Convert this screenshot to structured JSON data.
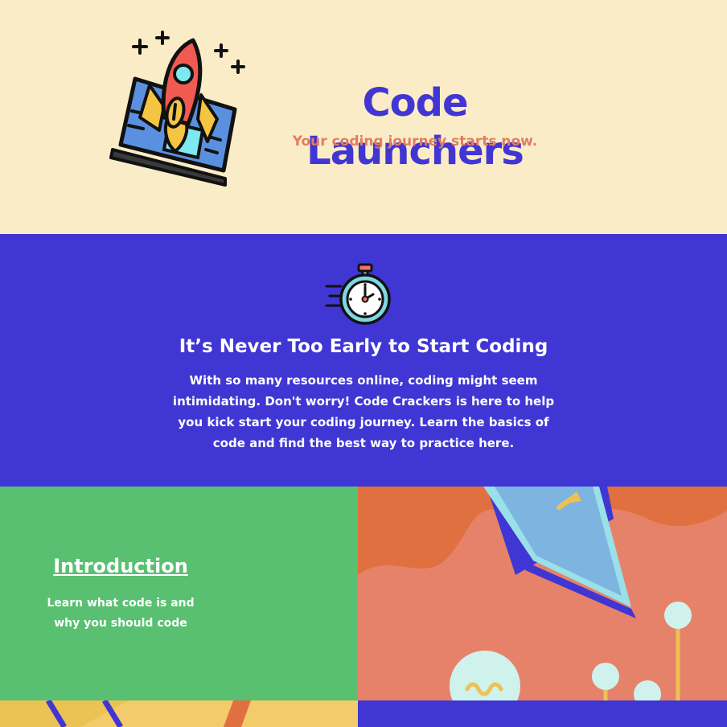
{
  "header": {
    "title": "Code Launchers",
    "tagline": "Your coding journey starts now.",
    "logo_icon": "rocket-laptop-icon"
  },
  "intro": {
    "icon": "stopwatch-icon",
    "heading": "It’s Never Too Early to Start Coding",
    "body": "With so many resources online, coding might seem intimidating. Don't worry! Code Crackers is here to help you kick start your coding journey. Learn the basics of code and find the best way to practice here."
  },
  "cards": [
    {
      "title": "Introduction",
      "description": "Learn what code is and why you should code",
      "illustration_icon": "laptop-lightbulb-illustration-icon"
    }
  ],
  "colors": {
    "cream": "#fbecc8",
    "primary": "#3f36d3",
    "accent": "#e27d60",
    "green": "#58c070",
    "orange": "#e17040",
    "yellow": "#edc254"
  }
}
